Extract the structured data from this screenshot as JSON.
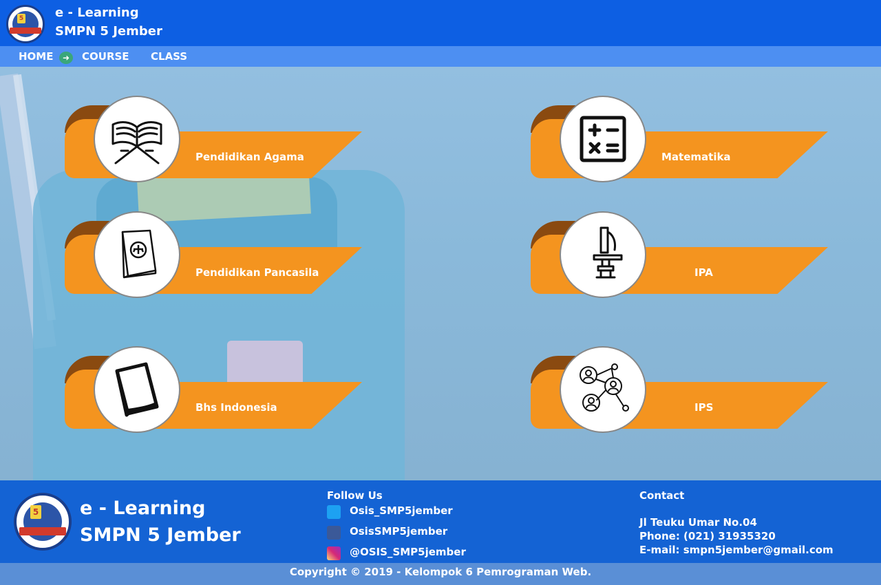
{
  "header": {
    "title_line1": "e - Learning",
    "title_line2": "SMPN 5 Jember",
    "logo_number": "5"
  },
  "nav": {
    "items": [
      {
        "label": "HOME"
      },
      {
        "label": "COURSE"
      },
      {
        "label": "CLASS"
      }
    ],
    "active_arrow": "➜"
  },
  "courses": [
    {
      "label": "Pendidikan Agama",
      "icon": "quran-stand-icon"
    },
    {
      "label": "Matematika",
      "icon": "math-operators-icon"
    },
    {
      "label": "Pendidikan Pancasila",
      "icon": "law-book-icon"
    },
    {
      "label": "IPA",
      "icon": "microscope-icon"
    },
    {
      "label": "Bhs Indonesia",
      "icon": "book-icon"
    },
    {
      "label": "IPS",
      "icon": "social-network-icon"
    }
  ],
  "footer": {
    "brand_line1": "e - Learning",
    "brand_line2": "SMPN 5 Jember",
    "follow_title": "Follow Us",
    "social": [
      {
        "name": "twitter-icon",
        "text": "Osis_SMP5jember",
        "color": "#1da1f2"
      },
      {
        "name": "facebook-icon",
        "text": "OsisSMP5jember",
        "color": "#3b5998"
      },
      {
        "name": "instagram-icon",
        "text": "@OSIS_SMP5jember",
        "color": "#d62976"
      }
    ],
    "contact_title": "Contact",
    "address": "Jl Teuku Umar No.04",
    "phone": "Phone: (021) 31935320",
    "email": "E-mail: smpn5jember@gmail.com",
    "copyright": "Copyright © 2019 - Kelompok 6 Pemrograman Web."
  },
  "colors": {
    "header": "#0d5fe3",
    "nav": "#4d8ff2",
    "card_orange": "#f4941f",
    "card_fold": "#8a4a10",
    "footer": "#1463d4"
  }
}
